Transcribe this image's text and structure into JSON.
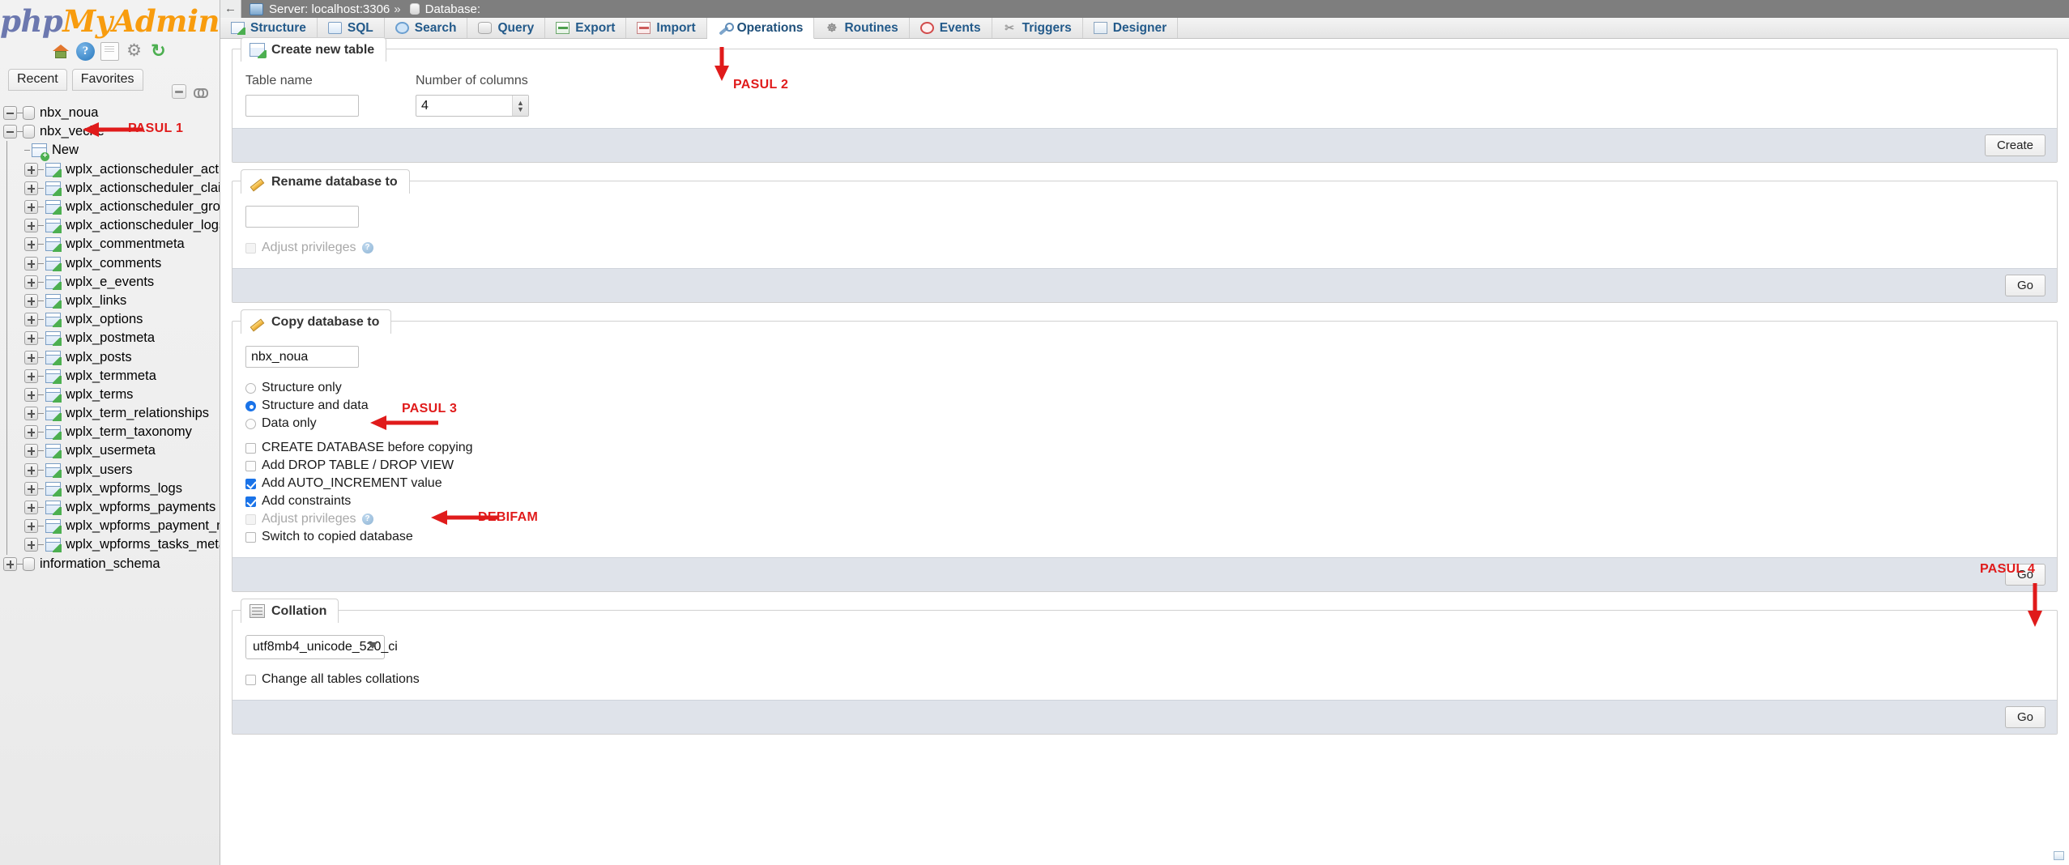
{
  "app": {
    "logo_php": "php",
    "logo_my": "My",
    "logo_admin": "Admin"
  },
  "sidebar": {
    "tabs": [
      {
        "label": "Recent"
      },
      {
        "label": "Favorites"
      }
    ],
    "tree": [
      {
        "label": "nbx_noua",
        "type": "database",
        "state": "collapsed-minus",
        "level": 0
      },
      {
        "label": "nbx_veche",
        "type": "database",
        "state": "expanded",
        "level": 0
      },
      {
        "label": "New",
        "type": "new",
        "level": 1
      },
      {
        "label": "wplx_actionscheduler_actions",
        "type": "table",
        "level": 1
      },
      {
        "label": "wplx_actionscheduler_claims",
        "type": "table",
        "level": 1
      },
      {
        "label": "wplx_actionscheduler_groups",
        "type": "table",
        "level": 1
      },
      {
        "label": "wplx_actionscheduler_logs",
        "type": "table",
        "level": 1
      },
      {
        "label": "wplx_commentmeta",
        "type": "table",
        "level": 1
      },
      {
        "label": "wplx_comments",
        "type": "table",
        "level": 1
      },
      {
        "label": "wplx_e_events",
        "type": "table",
        "level": 1
      },
      {
        "label": "wplx_links",
        "type": "table",
        "level": 1
      },
      {
        "label": "wplx_options",
        "type": "table",
        "level": 1
      },
      {
        "label": "wplx_postmeta",
        "type": "table",
        "level": 1
      },
      {
        "label": "wplx_posts",
        "type": "table",
        "level": 1
      },
      {
        "label": "wplx_termmeta",
        "type": "table",
        "level": 1
      },
      {
        "label": "wplx_terms",
        "type": "table",
        "level": 1
      },
      {
        "label": "wplx_term_relationships",
        "type": "table",
        "level": 1
      },
      {
        "label": "wplx_term_taxonomy",
        "type": "table",
        "level": 1
      },
      {
        "label": "wplx_usermeta",
        "type": "table",
        "level": 1
      },
      {
        "label": "wplx_users",
        "type": "table",
        "level": 1
      },
      {
        "label": "wplx_wpforms_logs",
        "type": "table",
        "level": 1
      },
      {
        "label": "wplx_wpforms_payments",
        "type": "table",
        "level": 1
      },
      {
        "label": "wplx_wpforms_payment_meta",
        "type": "table",
        "level": 1
      },
      {
        "label": "wplx_wpforms_tasks_meta",
        "type": "table",
        "level": 1
      },
      {
        "label": "information_schema",
        "type": "database",
        "state": "collapsed-plus",
        "level": 0
      }
    ]
  },
  "breadcrumb": {
    "back": "←",
    "server": "Server: localhost:3306",
    "separator": "»",
    "database": "Database:"
  },
  "tabs": [
    {
      "label": "Structure",
      "icon": "structure-icon",
      "active": false
    },
    {
      "label": "SQL",
      "icon": "sql-icon",
      "active": false
    },
    {
      "label": "Search",
      "icon": "search-icon",
      "active": false
    },
    {
      "label": "Query",
      "icon": "query-icon",
      "active": false
    },
    {
      "label": "Export",
      "icon": "export-icon",
      "active": false
    },
    {
      "label": "Import",
      "icon": "import-icon",
      "active": false
    },
    {
      "label": "Operations",
      "icon": "operations-icon",
      "active": true
    },
    {
      "label": "Routines",
      "icon": "routines-icon",
      "active": false
    },
    {
      "label": "Events",
      "icon": "events-icon",
      "active": false
    },
    {
      "label": "Triggers",
      "icon": "triggers-icon",
      "active": false
    },
    {
      "label": "Designer",
      "icon": "designer-icon",
      "active": false
    }
  ],
  "create_table": {
    "legend": "Create new table",
    "table_name_label": "Table name",
    "table_name_value": "",
    "num_columns_label": "Number of columns",
    "num_columns_value": "4",
    "button": "Create"
  },
  "rename_db": {
    "legend": "Rename database to",
    "value": "",
    "adjust_privileges": "Adjust privileges",
    "help": "?",
    "button": "Go"
  },
  "copy_db": {
    "legend": "Copy database to",
    "value": "nbx_noua",
    "radios": [
      {
        "label": "Structure only",
        "selected": false
      },
      {
        "label": "Structure and data",
        "selected": true
      },
      {
        "label": "Data only",
        "selected": false
      }
    ],
    "checkboxes": [
      {
        "label": "CREATE DATABASE before copying",
        "checked": false,
        "disabled": false
      },
      {
        "label": "Add DROP TABLE / DROP VIEW",
        "checked": false,
        "disabled": false
      },
      {
        "label": "Add AUTO_INCREMENT value",
        "checked": true,
        "disabled": false
      },
      {
        "label": "Add constraints",
        "checked": true,
        "disabled": false
      },
      {
        "label": "Adjust privileges",
        "checked": false,
        "disabled": true,
        "help": "?"
      },
      {
        "label": "Switch to copied database",
        "checked": false,
        "disabled": false
      }
    ],
    "button": "Go"
  },
  "collation": {
    "legend": "Collation",
    "selected": "utf8mb4_unicode_520_ci",
    "change_all_label": "Change all tables collations",
    "change_all_checked": false,
    "button": "Go"
  },
  "annotations": [
    {
      "text": "PASUL 1"
    },
    {
      "text": "PASUL 2"
    },
    {
      "text": "PASUL 3"
    },
    {
      "text": "DEBIFAM"
    },
    {
      "text": "PASUL 4"
    }
  ],
  "colors": {
    "annotation_red": "#e01b1b",
    "accent_blue": "#1a73e8",
    "logo_orange": "#f89c0e",
    "logo_blue": "#6c78af"
  }
}
